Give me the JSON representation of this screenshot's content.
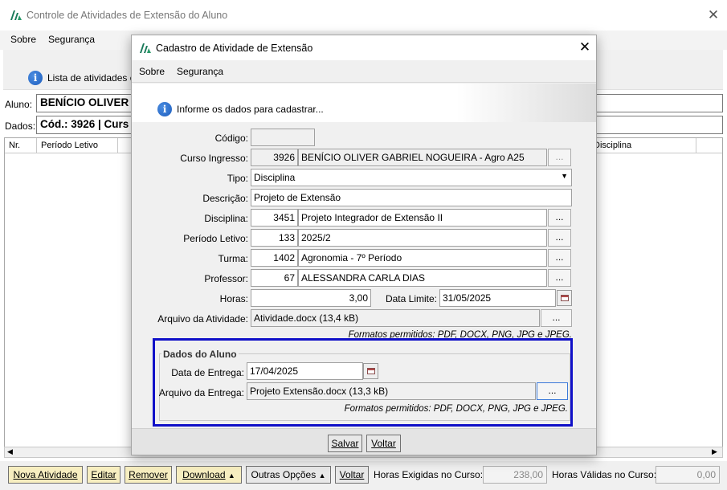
{
  "main": {
    "title": "Controle de Atividades de Extensão do Aluno",
    "menu": {
      "sobre": "Sobre",
      "seguranca": "Segurança"
    },
    "info_text": "Lista de atividades c",
    "aluno_label": "Aluno:",
    "aluno_value": "BENÍCIO OLIVER",
    "dados_label": "Dados:",
    "dados_value": "Cód.: 3926 | Curs",
    "grid_headers": [
      "Nr.",
      "Período Letivo",
      "",
      "Disciplina",
      ""
    ],
    "toolbar": {
      "nova_atividade": "Nova Atividade",
      "editar": "Editar",
      "remover": "Remover",
      "download": "Download",
      "outras_opcoes": "Outras Opções",
      "voltar": "Voltar",
      "horas_exigidas_label": "Horas Exigidas no Curso:",
      "horas_exigidas_value": "238,00",
      "horas_validas_label": "Horas Válidas no Curso:",
      "horas_validas_value": "0,00"
    }
  },
  "dialog": {
    "title": "Cadastro de Atividade de Extensão",
    "menu": {
      "sobre": "Sobre",
      "seguranca": "Segurança"
    },
    "info_text": "Informe os dados para cadastrar...",
    "fields": {
      "codigo_label": "Código:",
      "codigo_value": "",
      "curso_label": "Curso Ingresso:",
      "curso_code": "3926",
      "curso_name": "BENÍCIO OLIVER GABRIEL NOGUEIRA - Agro A25",
      "tipo_label": "Tipo:",
      "tipo_value": "Disciplina",
      "descricao_label": "Descrição:",
      "descricao_value": "Projeto de Extensão",
      "disciplina_label": "Disciplina:",
      "disciplina_code": "3451",
      "disciplina_name": "Projeto Integrador de Extensão II",
      "periodo_label": "Período Letivo:",
      "periodo_code": "133",
      "periodo_name": "2025/2",
      "turma_label": "Turma:",
      "turma_code": "1402",
      "turma_name": "Agronomia - 7º Período",
      "professor_label": "Professor:",
      "professor_code": "67",
      "professor_name": "ALESSANDRA CARLA DIAS",
      "horas_label": "Horas:",
      "horas_value": "3,00",
      "data_limite_label": "Data Limite:",
      "data_limite_value": "31/05/2025",
      "arquivo_atividade_label": "Arquivo da Atividade:",
      "arquivo_atividade_value": "Atividade.docx (13,4 kB)",
      "formatos_note_1": "Formatos permitidos: PDF, DOCX, PNG, JPG e JPEG."
    },
    "aluno_group": {
      "legend": "Dados do Aluno",
      "data_entrega_label": "Data de Entrega:",
      "data_entrega_value": "17/04/2025",
      "arquivo_entrega_label": "Arquivo da Entrega:",
      "arquivo_entrega_value": "Projeto Extensão.docx (13,3 kB)",
      "formatos_note_2": "Formatos permitidos: PDF, DOCX, PNG, JPG e JPEG."
    },
    "ellipsis": "...",
    "buttons": {
      "salvar": "Salvar",
      "voltar": "Voltar"
    }
  }
}
